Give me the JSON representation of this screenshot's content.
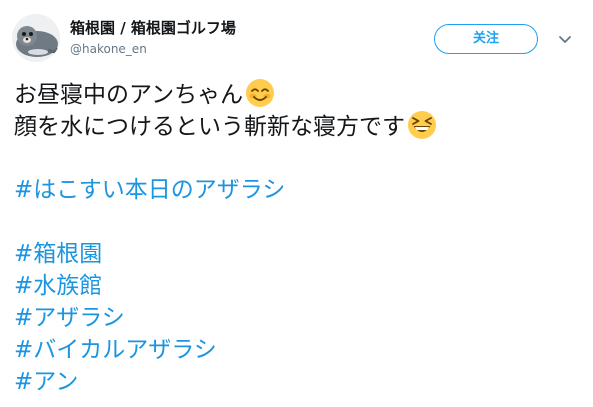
{
  "user": {
    "display_name": "箱根園 / 箱根園ゴルフ場",
    "handle": "@hakone_en"
  },
  "follow_label": "关注",
  "tweet": {
    "line1": "お昼寝中のアンちゃん",
    "line1_emoji": "smiling-face-with-smiling-eyes",
    "line2": "顔を水につけるという斬新な寝方です",
    "line2_emoji": "grinning-squinting-face",
    "hashtags": [
      "#はこすい本日のアザラシ",
      "#箱根園",
      "#水族館",
      "#アザラシ",
      "#バイカルアザラシ",
      "#アン"
    ]
  },
  "colors": {
    "accent": "#1da1f2",
    "hashtag": "#1b95e0",
    "text": "#14171a",
    "muted": "#657786"
  }
}
